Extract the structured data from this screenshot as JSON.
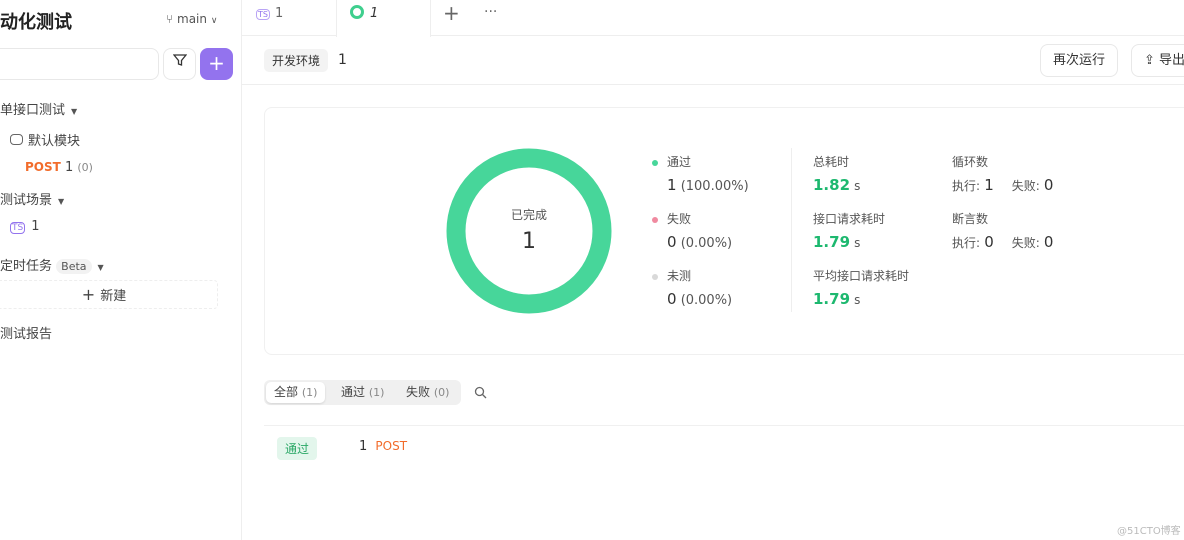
{
  "sidebar": {
    "title": "动化测试",
    "branch": "main",
    "items": {
      "single_api": "单接口测试",
      "default_module": "默认模块",
      "post_method": "POST",
      "post_name": "1",
      "post_count": "(0)",
      "scenarios": "测试场景",
      "scenario_item": "1",
      "scheduled": "定时任务",
      "beta": "Beta",
      "new": "新建",
      "reports": "测试报告"
    }
  },
  "tabs": [
    {
      "label": "1"
    },
    {
      "label": "1"
    }
  ],
  "header": {
    "env": "开发环境",
    "name": "1",
    "rerun": "再次运行",
    "export": "导出"
  },
  "summary": {
    "donut_label": "已完成",
    "donut_value": "1",
    "pass_rate": 1.0,
    "legend": [
      {
        "label": "通过",
        "count": "1",
        "pct": "(100.00%)",
        "color": "#47d69a"
      },
      {
        "label": "失败",
        "count": "0",
        "pct": "(0.00%)",
        "color": "#f08aa0"
      },
      {
        "label": "未测",
        "count": "0",
        "pct": "(0.00%)",
        "color": "#d9d9d9"
      }
    ],
    "total_time_label": "总耗时",
    "total_time": "1.82",
    "req_time_label": "接口请求耗时",
    "req_time": "1.79",
    "avg_time_label": "平均接口请求耗时",
    "avg_time": "1.79",
    "unit": "s",
    "loops_label": "循环数",
    "asserts_label": "断言数",
    "exec_label": "执行:",
    "fail_label": "失败:",
    "loops_exec": "1",
    "loops_fail": "0",
    "asserts_exec": "0",
    "asserts_fail": "0"
  },
  "filters": [
    {
      "label": "全部",
      "count": "(1)"
    },
    {
      "label": "通过",
      "count": "(1)"
    },
    {
      "label": "失败",
      "count": "(0)"
    }
  ],
  "results": [
    {
      "status": "通过",
      "name": "1",
      "method": "POST"
    }
  ],
  "watermark": "@51CTO博客"
}
